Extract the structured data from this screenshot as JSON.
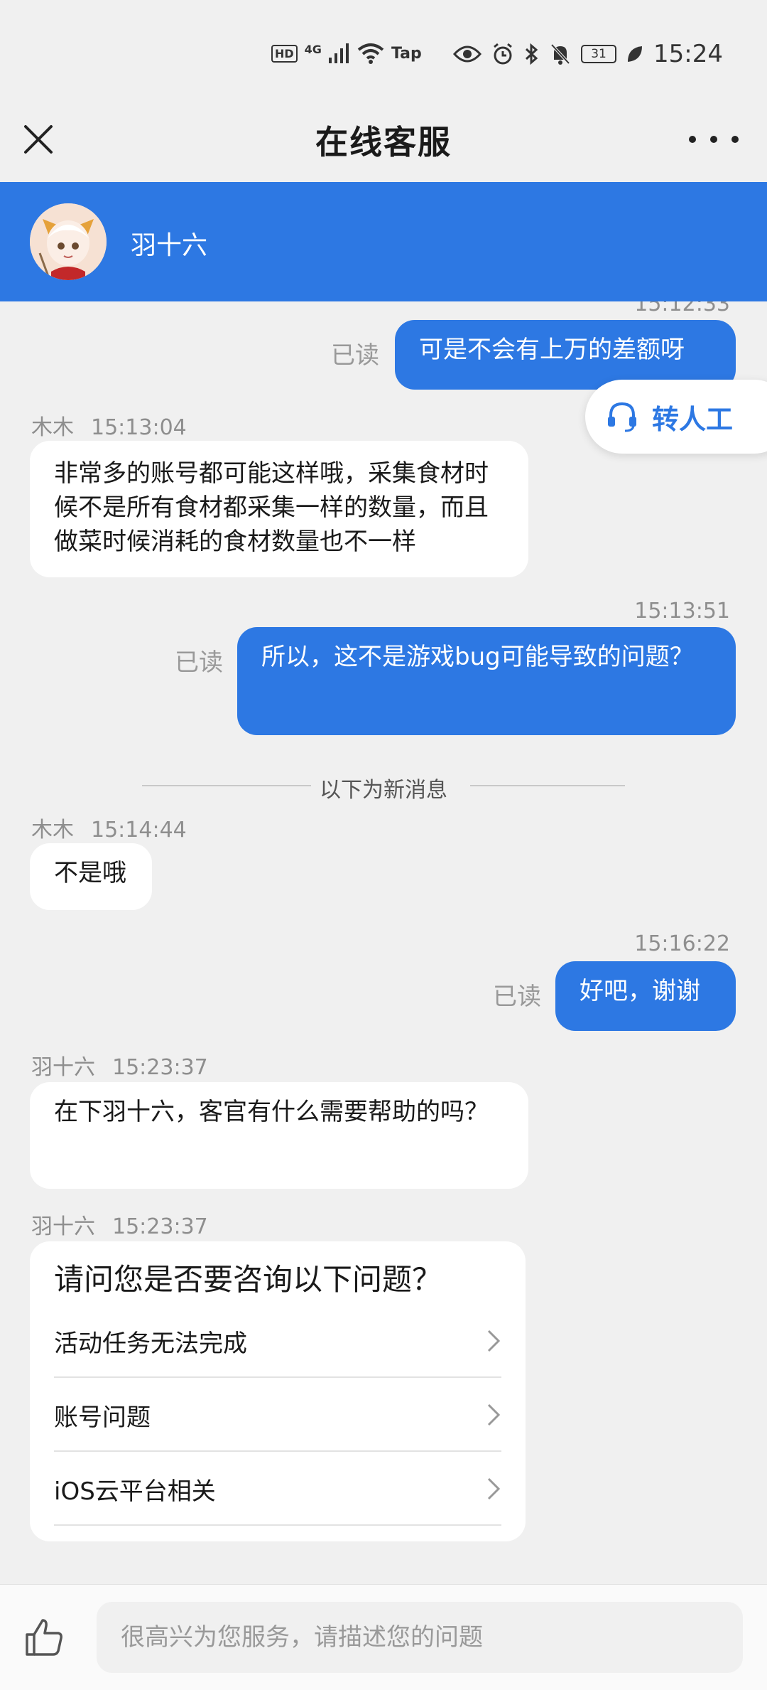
{
  "status": {
    "net_type": "4G",
    "hd": "HD",
    "wifi_label": "Tap",
    "battery": "31",
    "time": "15:24"
  },
  "header": {
    "title": "在线客服"
  },
  "agent": {
    "name": "羽十六"
  },
  "transfer": {
    "label": "转人工"
  },
  "chat": {
    "msg1": {
      "time": "15:12:33",
      "read": "已读",
      "text": "可是不会有上万的差额呀"
    },
    "msg2": {
      "sender": "木木",
      "time": "15:13:04",
      "text": "非常多的账号都可能这样哦，采集食材时候不是所有食材都采集一样的数量，而且做菜时候消耗的食材数量也不一样"
    },
    "msg3": {
      "time": "15:13:51",
      "read": "已读",
      "text": "所以，这不是游戏bug可能导致的问题？"
    },
    "divider": "以下为新消息",
    "msg4": {
      "sender": "木木",
      "time": "15:14:44",
      "text": "不是哦"
    },
    "msg5": {
      "time": "15:16:22",
      "read": "已读",
      "text": "好吧，谢谢"
    },
    "msg6": {
      "sender": "羽十六",
      "time": "15:23:37",
      "text": "在下羽十六，客官有什么需要帮助的吗？"
    },
    "msg7": {
      "sender": "羽十六",
      "time": "15:23:37"
    }
  },
  "faq": {
    "title": "请问您是否要咨询以下问题？",
    "items": [
      {
        "label": "活动任务无法完成"
      },
      {
        "label": "账号问题"
      },
      {
        "label": "iOS云平台相关"
      }
    ]
  },
  "input": {
    "placeholder": "很高兴为您服务，请描述您的问题"
  },
  "colors": {
    "accent": "#2d78e3",
    "background": "#f0f0f0",
    "bubble_in": "#ffffff"
  },
  "icons": {
    "close": "close-icon",
    "more": "more-icon",
    "headset": "headset-icon",
    "chevron": "chevron-right-icon",
    "like": "thumbs-up-icon"
  }
}
